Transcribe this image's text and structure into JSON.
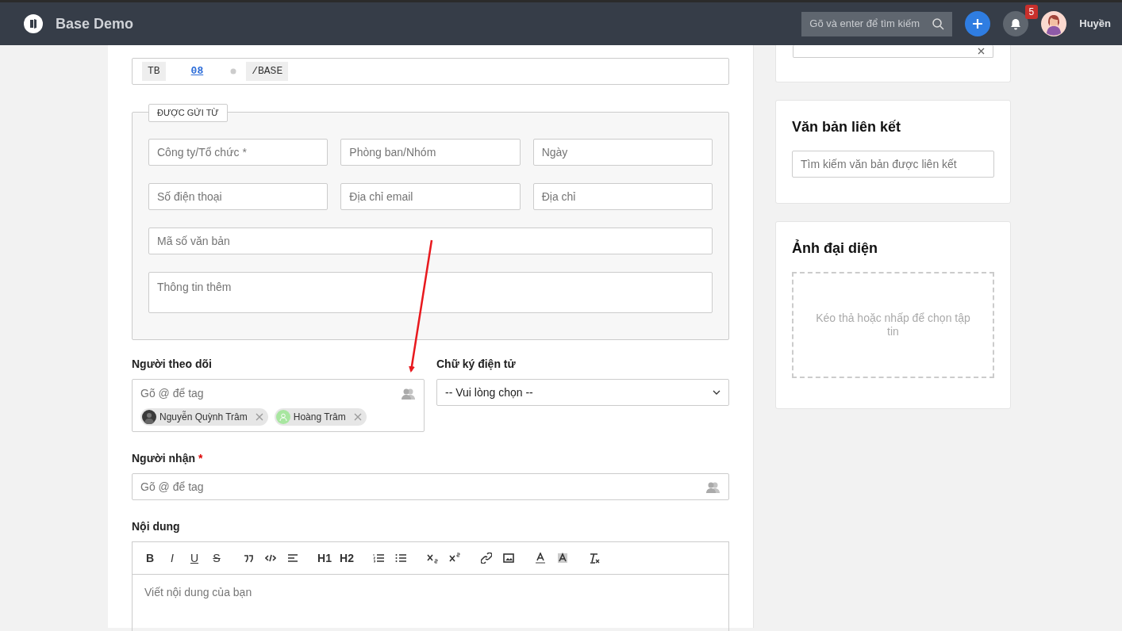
{
  "navbar": {
    "brand": "Base Demo",
    "search": {
      "placeholder": "Gõ và enter để tìm kiếm"
    },
    "notification_count": "5",
    "user_name": "Huyền"
  },
  "doc_code": {
    "parts": [
      {
        "kind": "tag",
        "text": "TB"
      },
      {
        "kind": "link",
        "text": "08"
      },
      {
        "kind": "dot"
      },
      {
        "kind": "tag",
        "text": "/BASE"
      }
    ]
  },
  "sender": {
    "legend": "ĐƯỢC GỬI TỪ",
    "rows": [
      {
        "fields": [
          {
            "placeholder": "Công ty/Tổ chức *"
          },
          {
            "placeholder": "Phòng ban/Nhóm"
          },
          {
            "placeholder": "Ngày"
          }
        ]
      },
      {
        "fields": [
          {
            "placeholder": "Số điện thoại"
          },
          {
            "placeholder": "Địa chỉ email"
          },
          {
            "placeholder": "Địa chỉ"
          }
        ]
      },
      {
        "fields": [
          {
            "placeholder": "Mã số văn bản"
          }
        ]
      },
      {
        "fields": [
          {
            "placeholder": "Thông tin thêm",
            "kind": "textarea"
          }
        ]
      }
    ]
  },
  "followers": {
    "label": "Người theo dõi",
    "placeholder": "Gõ @ để tag",
    "tags": [
      {
        "name": "Nguyễn Quỳnh Trâm",
        "kind": "photo"
      },
      {
        "name": "Hoàng Trâm",
        "kind": "default"
      }
    ]
  },
  "signature": {
    "label": "Chữ ký điện tử",
    "value": "-- Vui lòng chọn --"
  },
  "recipients": {
    "label": "Người nhận",
    "required_mark": "*",
    "placeholder": "Gõ @ để tag"
  },
  "content": {
    "label": "Nội dung",
    "placeholder": "Viết nội dung của bạn",
    "toolbar": [
      [
        {
          "kind": "bold",
          "label": "B"
        },
        {
          "kind": "italic",
          "label": "I"
        },
        {
          "kind": "underline",
          "label": "U"
        },
        {
          "kind": "strike",
          "label": "S"
        }
      ],
      [
        {
          "kind": "quote"
        },
        {
          "kind": "code"
        },
        {
          "kind": "align"
        }
      ],
      [
        {
          "kind": "heading",
          "label": "H1"
        },
        {
          "kind": "heading",
          "label": "H2"
        }
      ],
      [
        {
          "kind": "ol"
        },
        {
          "kind": "ul"
        }
      ],
      [
        {
          "kind": "sub"
        },
        {
          "kind": "sup"
        }
      ],
      [
        {
          "kind": "link"
        },
        {
          "kind": "image"
        }
      ],
      [
        {
          "kind": "color"
        },
        {
          "kind": "background"
        }
      ],
      [
        {
          "kind": "clear"
        }
      ]
    ]
  },
  "sidebar": {
    "linked": {
      "title": "Văn bản liên kết",
      "placeholder": "Tìm kiếm văn bản được liên kết"
    },
    "avatar": {
      "title": "Ảnh đại diện",
      "dropzone": "Kéo thả hoặc nhấp để chọn tập tin"
    }
  }
}
